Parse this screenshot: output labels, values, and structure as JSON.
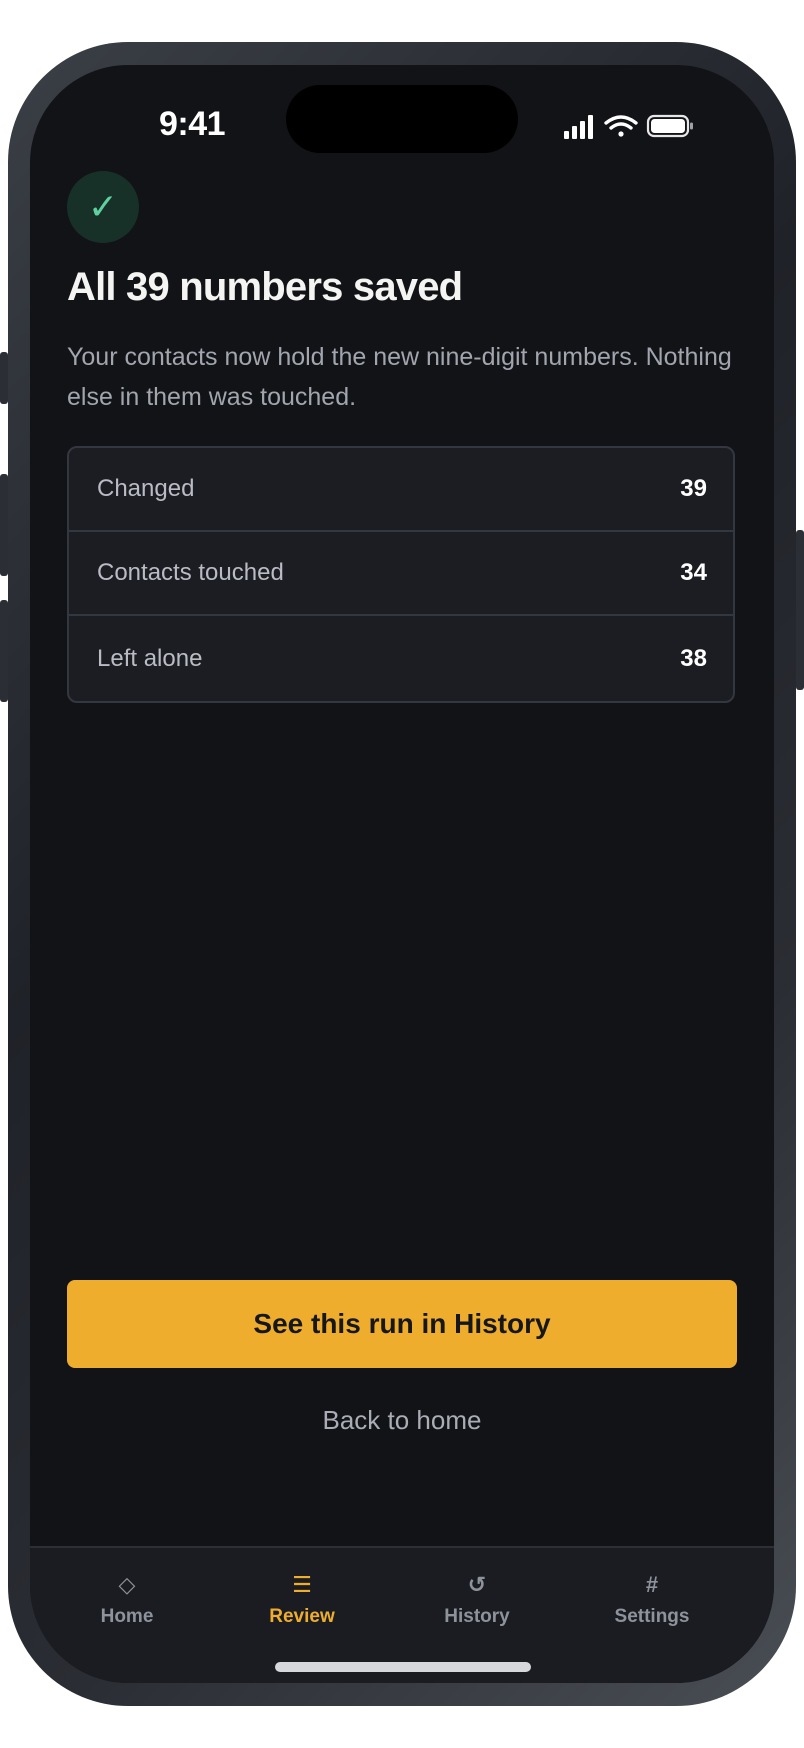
{
  "status_bar": {
    "time": "9:41"
  },
  "header": {
    "check_icon": "✓",
    "title": "All 39 numbers saved",
    "description": "Your contacts now hold the new nine-digit numbers. Nothing else in them was touched."
  },
  "stats": [
    {
      "label": "Changed",
      "value": "39"
    },
    {
      "label": "Contacts touched",
      "value": "34"
    },
    {
      "label": "Left alone",
      "value": "38"
    }
  ],
  "actions": {
    "primary_label": "See this run in History",
    "secondary_label": "Back to home"
  },
  "tabs": [
    {
      "label": "Home",
      "icon": "◇",
      "icon_name": "diamond-icon"
    },
    {
      "label": "Review",
      "icon": "☰",
      "icon_name": "list-icon",
      "active": true
    },
    {
      "label": "History",
      "icon": "↺",
      "icon_name": "history-icon"
    },
    {
      "label": "Settings",
      "icon": "#",
      "icon_name": "hash-icon"
    }
  ],
  "colors": {
    "background": "#121317",
    "accent": "#efad2e",
    "success": "#5fd0a1",
    "card": "#1b1d23"
  }
}
